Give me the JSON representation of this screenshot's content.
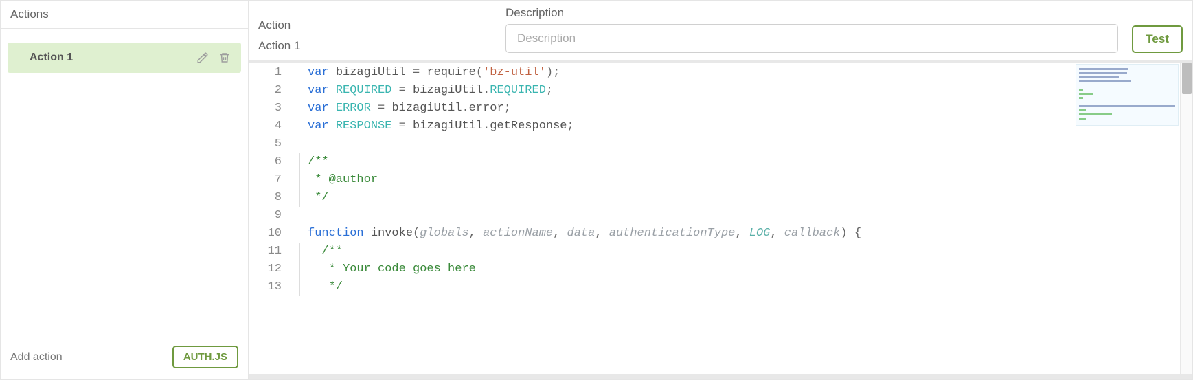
{
  "sidebar": {
    "title": "Actions",
    "items": [
      {
        "label": "Action 1",
        "selected": true
      }
    ],
    "add_label": "Add action",
    "auth_label": "AUTH.JS"
  },
  "header": {
    "action_label": "Action",
    "action_value": "Action 1",
    "description_label": "Description",
    "description_placeholder": "Description",
    "description_value": "",
    "test_label": "Test"
  },
  "editor": {
    "lines": [
      {
        "n": 1,
        "tokens": [
          [
            "kw",
            "var"
          ],
          [
            "sp",
            " "
          ],
          [
            "ident",
            "bizagiUtil"
          ],
          [
            "sp",
            " "
          ],
          [
            "punc",
            "="
          ],
          [
            "sp",
            " "
          ],
          [
            "ident",
            "require"
          ],
          [
            "punc",
            "("
          ],
          [
            "str",
            "'bz-util'"
          ],
          [
            "punc",
            ")"
          ],
          [
            "punc",
            ";"
          ]
        ]
      },
      {
        "n": 2,
        "tokens": [
          [
            "kw",
            "var"
          ],
          [
            "sp",
            " "
          ],
          [
            "type",
            "REQUIRED"
          ],
          [
            "sp",
            " "
          ],
          [
            "punc",
            "="
          ],
          [
            "sp",
            " "
          ],
          [
            "ident",
            "bizagiUtil"
          ],
          [
            "punc",
            "."
          ],
          [
            "type",
            "REQUIRED"
          ],
          [
            "punc",
            ";"
          ]
        ]
      },
      {
        "n": 3,
        "tokens": [
          [
            "kw",
            "var"
          ],
          [
            "sp",
            " "
          ],
          [
            "type",
            "ERROR"
          ],
          [
            "sp",
            " "
          ],
          [
            "punc",
            "="
          ],
          [
            "sp",
            " "
          ],
          [
            "ident",
            "bizagiUtil"
          ],
          [
            "punc",
            "."
          ],
          [
            "ident",
            "error"
          ],
          [
            "punc",
            ";"
          ]
        ]
      },
      {
        "n": 4,
        "tokens": [
          [
            "kw",
            "var"
          ],
          [
            "sp",
            " "
          ],
          [
            "type",
            "RESPONSE"
          ],
          [
            "sp",
            " "
          ],
          [
            "punc",
            "="
          ],
          [
            "sp",
            " "
          ],
          [
            "ident",
            "bizagiUtil"
          ],
          [
            "punc",
            "."
          ],
          [
            "ident",
            "getResponse"
          ],
          [
            "punc",
            ";"
          ]
        ]
      },
      {
        "n": 5,
        "tokens": []
      },
      {
        "n": 6,
        "tokens": [
          [
            "comment",
            "/**"
          ]
        ],
        "guide": 1
      },
      {
        "n": 7,
        "tokens": [
          [
            "comment",
            " * @author"
          ]
        ],
        "guide": 1
      },
      {
        "n": 8,
        "tokens": [
          [
            "comment",
            " */"
          ]
        ],
        "guide": 1
      },
      {
        "n": 9,
        "tokens": []
      },
      {
        "n": 10,
        "tokens": [
          [
            "kw",
            "function"
          ],
          [
            "sp",
            " "
          ],
          [
            "ident",
            "invoke"
          ],
          [
            "punc",
            "("
          ],
          [
            "param",
            "globals"
          ],
          [
            "punc",
            ","
          ],
          [
            "sp",
            " "
          ],
          [
            "param",
            "actionName"
          ],
          [
            "punc",
            ","
          ],
          [
            "sp",
            " "
          ],
          [
            "param",
            "data"
          ],
          [
            "punc",
            ","
          ],
          [
            "sp",
            " "
          ],
          [
            "param",
            "authenticationType"
          ],
          [
            "punc",
            ","
          ],
          [
            "sp",
            " "
          ],
          [
            "param-accent",
            "LOG"
          ],
          [
            "punc",
            ","
          ],
          [
            "sp",
            " "
          ],
          [
            "param",
            "callback"
          ],
          [
            "punc",
            ")"
          ],
          [
            "sp",
            " "
          ],
          [
            "punc",
            "{"
          ]
        ]
      },
      {
        "n": 11,
        "tokens": [
          [
            "sp",
            "  "
          ],
          [
            "comment",
            "/**"
          ]
        ],
        "guide": 2
      },
      {
        "n": 12,
        "tokens": [
          [
            "sp",
            "  "
          ],
          [
            "comment",
            " * Your code goes here"
          ]
        ],
        "guide": 2
      },
      {
        "n": 13,
        "tokens": [
          [
            "sp",
            "  "
          ],
          [
            "comment",
            " */"
          ]
        ],
        "guide": 2
      }
    ]
  }
}
